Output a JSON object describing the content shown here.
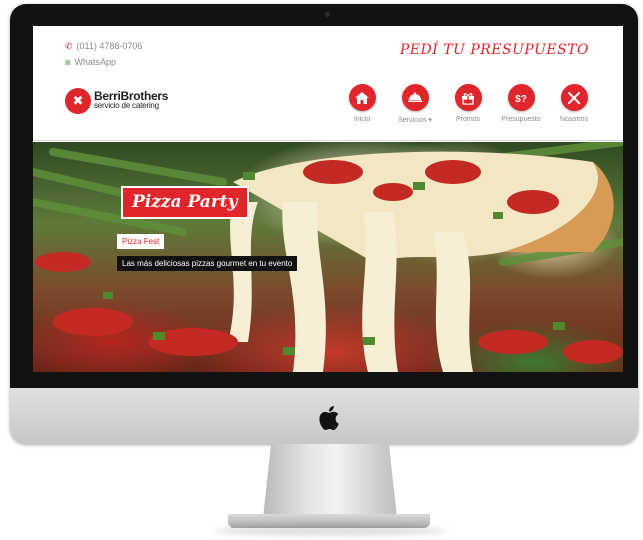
{
  "header": {
    "phone": "(011) 4788-0706",
    "whatsapp": "WhatsApp",
    "quote_cta": "PEDÍ TU PRESUPUESTO"
  },
  "brand": {
    "name": "BerriBrothers",
    "tagline": "servicio de catering"
  },
  "nav": {
    "items": [
      {
        "label": "Inicio",
        "icon": "home-icon"
      },
      {
        "label": "Servicios ▾",
        "icon": "cloche-icon"
      },
      {
        "label": "Promos",
        "icon": "gift-icon"
      },
      {
        "label": "Presupuesto",
        "icon": "money-icon"
      },
      {
        "label": "Nosotros",
        "icon": "utensils-icon"
      }
    ]
  },
  "hero": {
    "title": "Pizza Party",
    "tag": "Pizza Fest",
    "description": "Las más deliciosas pizzas gourmet en tu evento"
  },
  "colors": {
    "accent": "#e0262a",
    "text_muted": "#8a8a8a",
    "bezel": "#121212"
  }
}
